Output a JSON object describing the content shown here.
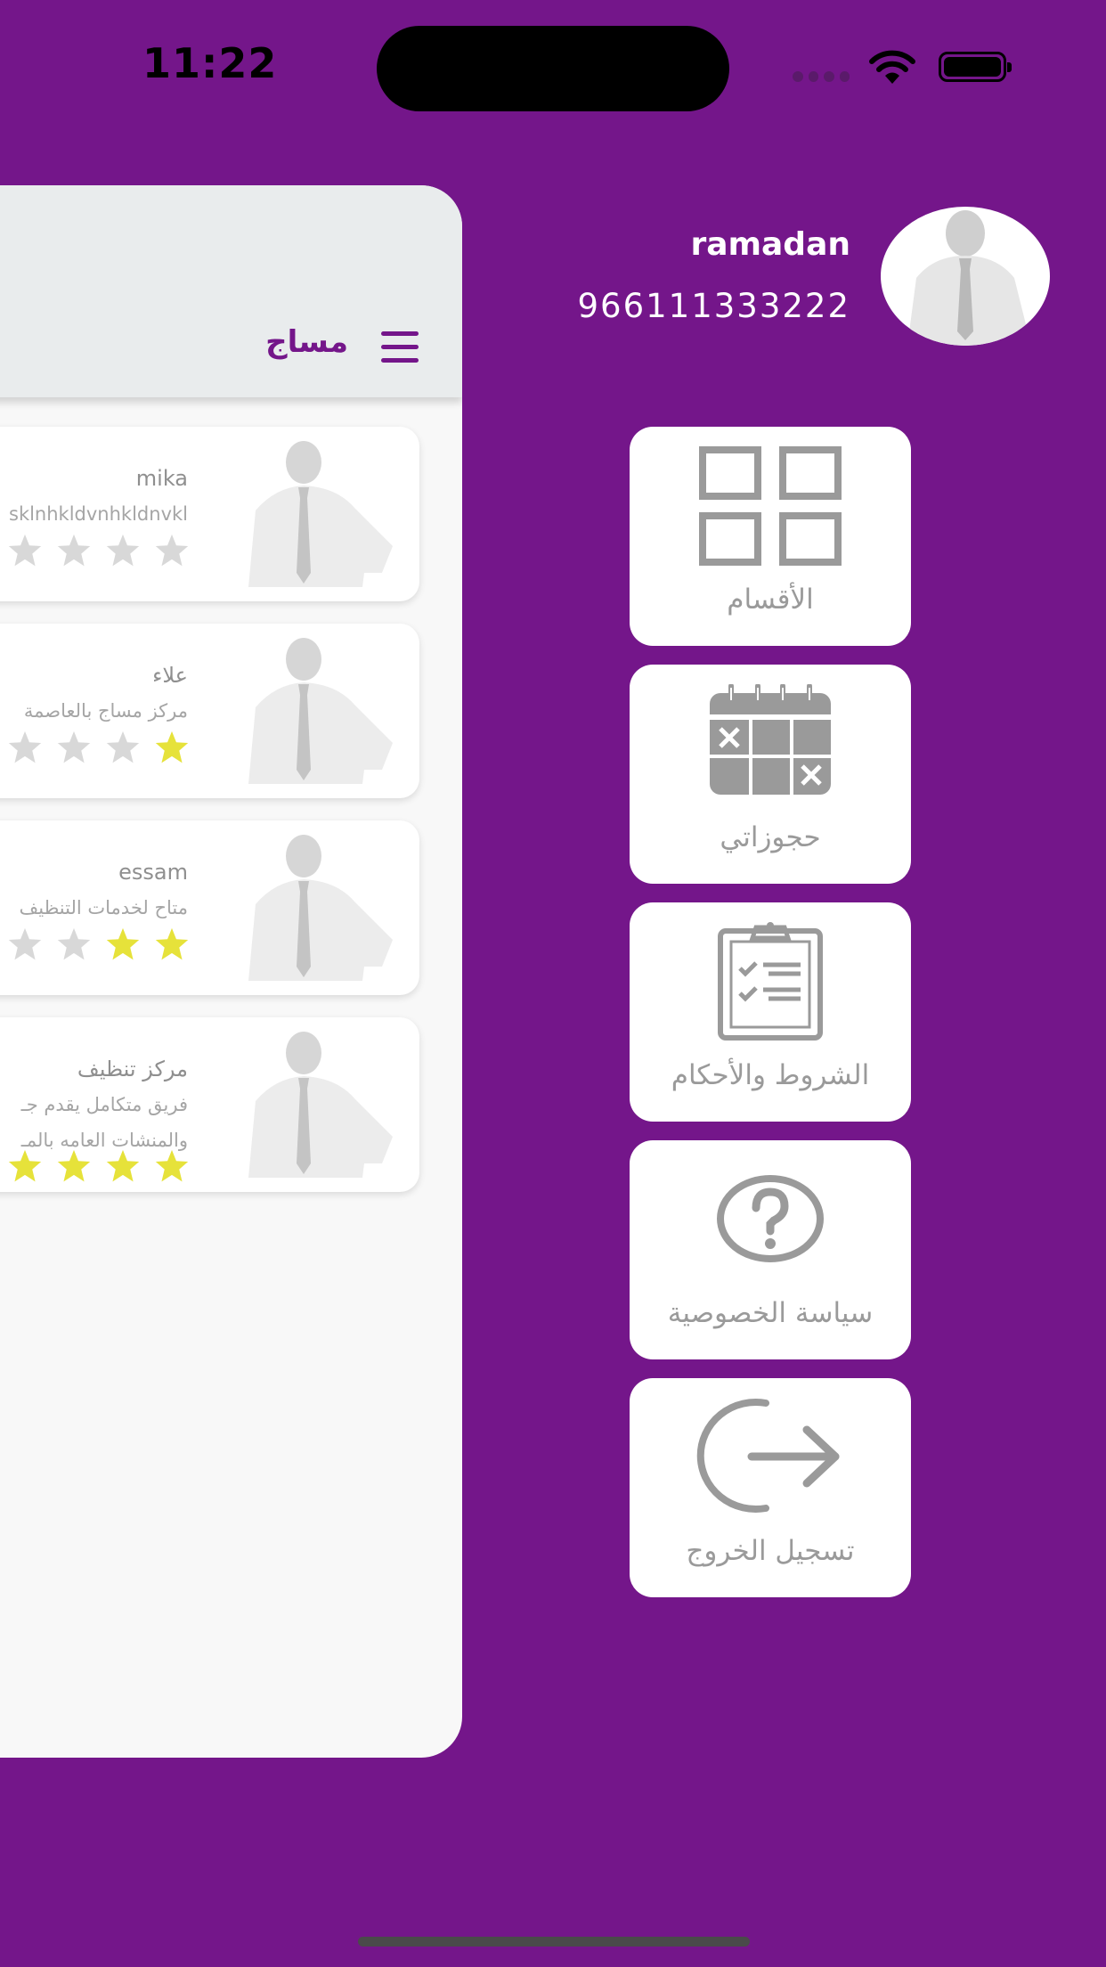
{
  "status_bar": {
    "time": "11:22"
  },
  "profile": {
    "name": "ramadan",
    "phone": "966111333222",
    "avatar_icon": "person-avatar-icon"
  },
  "drawer_menu": [
    {
      "label": "الأقسام",
      "icon": "grid-icon"
    },
    {
      "label": "حجوزاتي",
      "icon": "calendar-icon"
    },
    {
      "label": "الشروط والأحكام",
      "icon": "clipboard-checklist-icon"
    },
    {
      "label": "سياسة الخصوصية",
      "icon": "question-circle-icon"
    },
    {
      "label": "تسجيل الخروج",
      "icon": "logout-icon"
    }
  ],
  "page": {
    "title": "مساج",
    "menu_icon": "hamburger-icon"
  },
  "providers": [
    {
      "name": "mika",
      "desc": "sklnhkldvnhkldnvkl",
      "desc2": "",
      "rating": 0
    },
    {
      "name": "علاء",
      "desc": "مركز مساج بالعاصمة",
      "desc2": "",
      "rating": 1
    },
    {
      "name": "essam",
      "desc": "متاح لخدمات التنظيف",
      "desc2": "",
      "rating": 2
    },
    {
      "name": "مركز تنظيف",
      "desc": "فريق متكامل يقدم جـ",
      "desc2": "والمنشات العامه بالمـ",
      "rating": 4
    }
  ],
  "colors": {
    "background": "#74168a",
    "accent": "#74168a",
    "star_filled": "#e6e23a",
    "star_empty": "#d8d8d8",
    "tile_icon": "#9a9a9a"
  }
}
